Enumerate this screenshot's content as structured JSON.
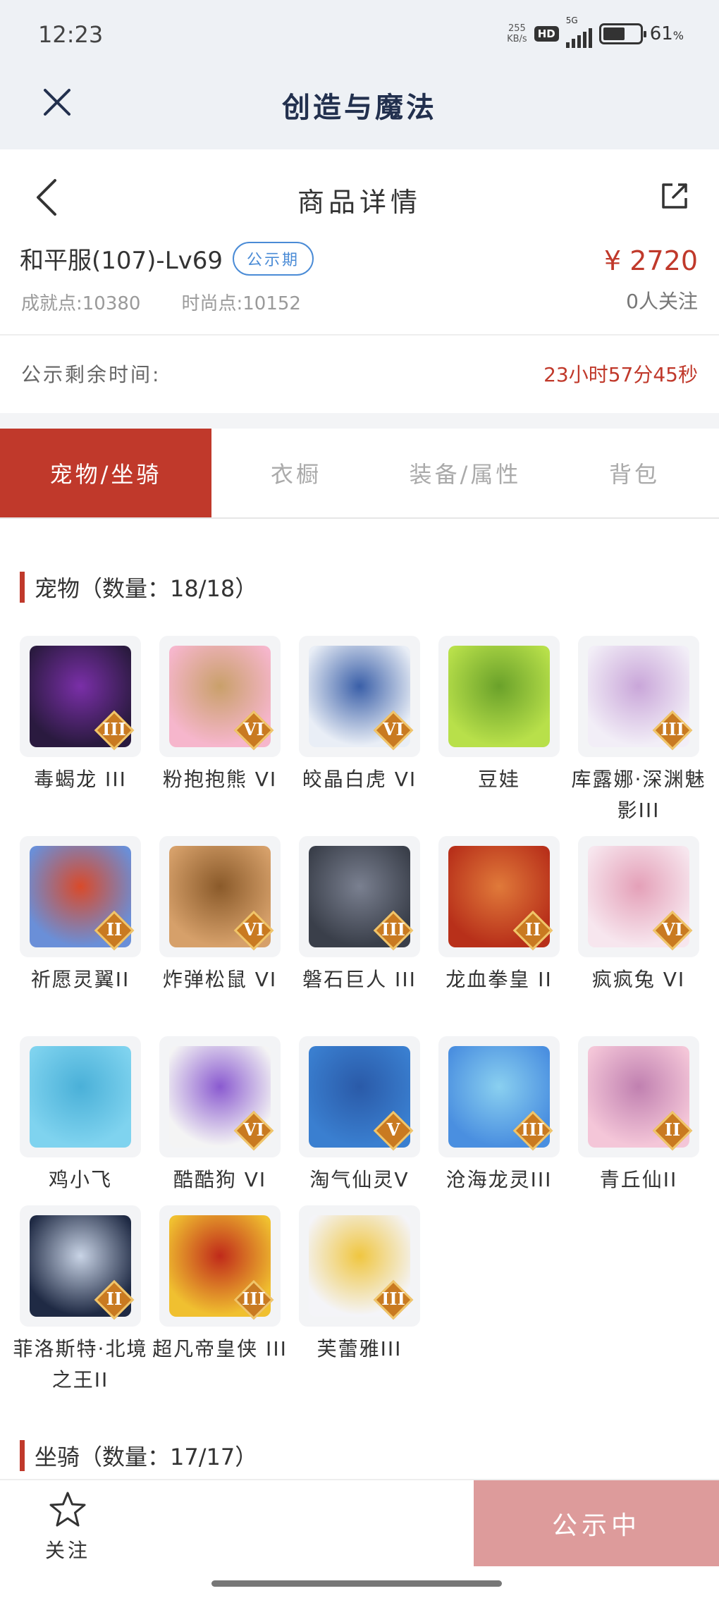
{
  "status_bar": {
    "time": "12:23",
    "net_speed_top": "255",
    "net_speed_bottom": "KB/s",
    "hd": "HD",
    "network": "5G",
    "battery": "61",
    "battery_fraction": 0.61,
    "battery_unit": "%"
  },
  "app": {
    "title": "创造与魔法"
  },
  "nav": {
    "title": "商品详情"
  },
  "product": {
    "name": "和平服(107)-Lv69",
    "badge": "公示期",
    "achievement": "成就点:10380",
    "fashion": "时尚点:10152",
    "price": "¥ 2720",
    "followers": "0人关注"
  },
  "countdown": {
    "label": "公示剩余时间:",
    "value": "23小时57分45秒"
  },
  "tabs": [
    {
      "label": "宠物/坐骑",
      "active": true
    },
    {
      "label": "衣橱",
      "active": false
    },
    {
      "label": "装备/属性",
      "active": false
    },
    {
      "label": "背包",
      "active": false
    }
  ],
  "pets_section": {
    "title": "宠物（数量：18/18）"
  },
  "pets": [
    {
      "name": "毒蝎龙 III",
      "tier": "III",
      "colors": [
        "#2a1a3f",
        "#7a2fa8"
      ]
    },
    {
      "name": "粉抱抱熊 VI",
      "tier": "VI",
      "colors": [
        "#f6b6cc",
        "#c9a06a"
      ]
    },
    {
      "name": "皎晶白虎 VI",
      "tier": "VI",
      "colors": [
        "#e9eef6",
        "#3a5fa8"
      ]
    },
    {
      "name": "豆娃",
      "tier": "",
      "colors": [
        "#b8e04a",
        "#6aa12a"
      ]
    },
    {
      "name": "库露娜·深渊魅影III",
      "tier": "III",
      "colors": [
        "#f2eef7",
        "#c9a6d9"
      ]
    },
    {
      "name": "祈愿灵翼II",
      "tier": "II",
      "colors": [
        "#6a8fd8",
        "#d94a2a"
      ]
    },
    {
      "name": "炸弹松鼠 VI",
      "tier": "VI",
      "colors": [
        "#d6a06a",
        "#8a5a2a"
      ]
    },
    {
      "name": "磐石巨人 III",
      "tier": "III",
      "colors": [
        "#3a3f4a",
        "#7a8090"
      ]
    },
    {
      "name": "龙血拳皇 II",
      "tier": "II",
      "colors": [
        "#b8301a",
        "#e07a3a"
      ]
    },
    {
      "name": "疯疯兔 VI",
      "tier": "VI",
      "colors": [
        "#f7e6ee",
        "#e4a0b8"
      ]
    },
    {
      "name": "鸡小飞",
      "tier": "",
      "colors": [
        "#7fd3ef",
        "#4ab0d8"
      ]
    },
    {
      "name": "酷酷狗 VI",
      "tier": "VI",
      "colors": [
        "#f4f4f4",
        "#8a5ad0"
      ]
    },
    {
      "name": "淘气仙灵V",
      "tier": "V",
      "colors": [
        "#3a7fd0",
        "#2a5aa8"
      ]
    },
    {
      "name": "沧海龙灵III",
      "tier": "III",
      "colors": [
        "#4a8fe0",
        "#8ad0f0"
      ]
    },
    {
      "name": "青丘仙II",
      "tier": "II",
      "colors": [
        "#f4c6d8",
        "#c080b0"
      ]
    },
    {
      "name": "菲洛斯特·北境之王II",
      "tier": "II",
      "colors": [
        "#1f2a44",
        "#c9d4e6"
      ]
    },
    {
      "name": "超凡帝皇侠 III",
      "tier": "III",
      "colors": [
        "#f0c030",
        "#c02a1a"
      ]
    },
    {
      "name": "芙蕾雅III",
      "tier": "III",
      "colors": [
        "#f4f4f8",
        "#f0c640"
      ]
    }
  ],
  "mounts_section": {
    "title": "坐骑（数量：17/17）"
  },
  "bottom": {
    "fav_label": "关注",
    "cta_label": "公示中"
  }
}
